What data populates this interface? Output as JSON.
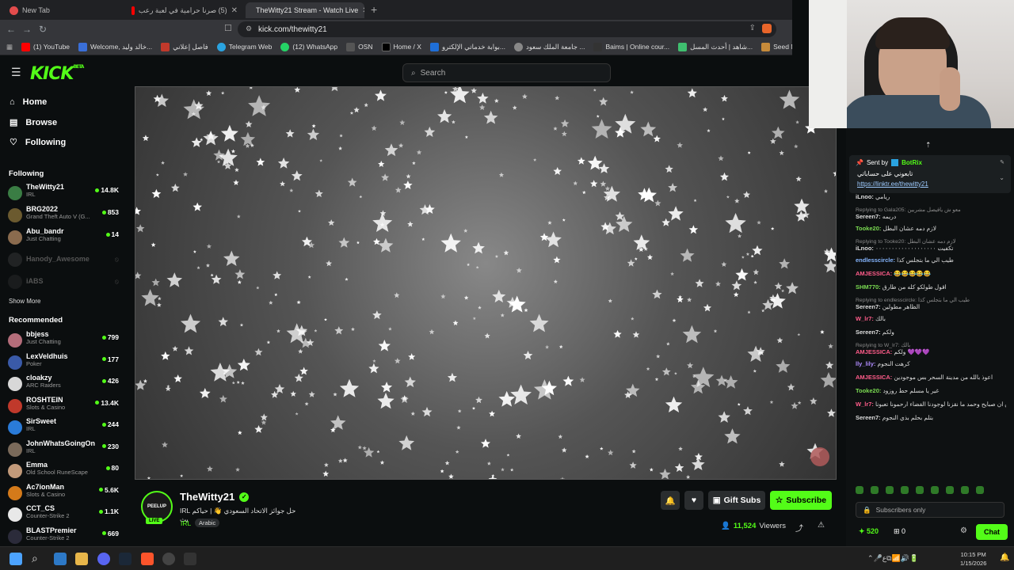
{
  "browser": {
    "tabs": [
      {
        "label": "New Tab"
      },
      {
        "label": "(5) صرنا حرامية في لعبة رعب"
      },
      {
        "label": "TheWitty21 Stream - Watch Live"
      }
    ],
    "url": "kick.com/thewitty21",
    "bookmarks": [
      "(1) YouTube",
      "Welcome, خالد وليد...",
      "فاصل إعلاني",
      "Telegram Web",
      "(12) WhatsApp",
      "OSN",
      "Home / X",
      "بوابة خدماتي الإلكترو...",
      "جامعة الملك سعود ...",
      "Baims | Online cour...",
      "شاهد | أحدث المسل...",
      "Seed Map - Minecra..."
    ]
  },
  "header": {
    "logo": "KICK",
    "logo_badge": "BETA",
    "search_placeholder": "Search"
  },
  "sidebar": {
    "nav": [
      {
        "label": "Home"
      },
      {
        "label": "Browse"
      },
      {
        "label": "Following"
      }
    ],
    "following_title": "Following",
    "following": [
      {
        "name": "TheWitty21",
        "category": "IRL",
        "viewers": "14.8K",
        "color": "#3a7d44"
      },
      {
        "name": "BRG2022",
        "category": "Grand Theft Auto V (G...",
        "viewers": "853",
        "color": "#6b5a2f"
      },
      {
        "name": "Abu_bandr",
        "category": "Just Chatting",
        "viewers": "14",
        "color": "#8a6b4e"
      },
      {
        "name": "Hanody_Awesome",
        "category": "",
        "viewers": "",
        "color": "#444"
      },
      {
        "name": "iABS",
        "category": "",
        "viewers": "",
        "color": "#333"
      }
    ],
    "show_more": "Show More",
    "recommended_title": "Recommended",
    "recommended": [
      {
        "name": "bbjess",
        "category": "Just Chatting",
        "viewers": "799",
        "color": "#b46d7a"
      },
      {
        "name": "LexVeldhuis",
        "category": "Poker",
        "viewers": "177",
        "color": "#3a5aa8"
      },
      {
        "name": "cloakzy",
        "category": "ARC Raiders",
        "viewers": "426",
        "color": "#d8d8d8"
      },
      {
        "name": "ROSHTEIN",
        "category": "Slots & Casino",
        "viewers": "13.4K",
        "color": "#c0392b"
      },
      {
        "name": "SirSweet",
        "category": "IRL",
        "viewers": "244",
        "color": "#2a7bd8"
      },
      {
        "name": "JohnWhatsGoingOn",
        "category": "IRL",
        "viewers": "230",
        "color": "#7a6a5a"
      },
      {
        "name": "Emma",
        "category": "Old School RuneScape",
        "viewers": "80",
        "color": "#c29a7a"
      },
      {
        "name": "Ac7ionMan",
        "category": "Slots & Casino",
        "viewers": "5.6K",
        "color": "#d47a1a"
      },
      {
        "name": "CCT_CS",
        "category": "Counter-Strike 2",
        "viewers": "1.1K",
        "color": "#e8e8e8"
      },
      {
        "name": "BLASTPremier",
        "category": "Counter-Strike 2",
        "viewers": "669",
        "color": "#2b2b3a"
      }
    ]
  },
  "stream": {
    "channel": "TheWitty21",
    "title": "حل جوائز الاتحاد السعودي 👋 | حياكم IRL بث",
    "category": "IRL",
    "tag": "Arabic",
    "live_badge": "LIVE",
    "avatar_text": "PEELUP",
    "viewers_count": "11,524",
    "viewers_label": "Viewers",
    "gift_label": "Gift Subs",
    "subscribe_label": "Subscribe"
  },
  "chat": {
    "pinned_sender_prefix": "Sent by",
    "pinned_sender": "BotRix",
    "pinned_text": "تابعوني على حساباتي",
    "pinned_link": "https://linktr.ee/thewitty21",
    "messages": [
      {
        "reply": "",
        "user": "iLnoo:",
        "text": "ريامي",
        "color": "#ddd"
      },
      {
        "reply": "Replying to Gala205: معو ش يافيصل مشربين",
        "user": "Sereen7:",
        "text": "دريمه",
        "color": "#ddd"
      },
      {
        "reply": "",
        "user": "Tooke20:",
        "text": "لازم دمه عشان البطل",
        "color": "#7bdc52"
      },
      {
        "reply": "Replying to Tooke20: لازم دمه عشان البطل",
        "user": "iLnoo:",
        "text": "تكفيت ٠٠٠٠٠٠٠٠٠٠٠٠٠٠٠٠٠٠٠",
        "color": "#ddd"
      },
      {
        "reply": "",
        "user": "endlesscircle:",
        "text": "طيب الي ما بتجلس كذا",
        "color": "#86b6ff"
      },
      {
        "reply": "",
        "user": "AMJESSICA:",
        "text": "😂😂😂😂😂",
        "color": "#ff5c8a"
      },
      {
        "reply": "",
        "user": "SHM770:",
        "text": "اقول طولكو كله من طارق",
        "color": "#7bdc52"
      },
      {
        "reply": "Replying to endlesscircle: طيب الي ما بتجلس كذا",
        "user": "Sereen7:",
        "text": "الظاهر مطولين",
        "color": "#ddd"
      },
      {
        "reply": "",
        "user": "W_lr7:",
        "text": "بالك",
        "color": "#ff5c8a"
      },
      {
        "reply": "",
        "user": "Sereen7:",
        "text": "ولكم",
        "color": "#ddd"
      },
      {
        "reply": "Replying to W_lr7: بالك",
        "user": "AMJESSICA:",
        "text": "ولكم 💜💜💜",
        "color": "#ff5c8a"
      },
      {
        "reply": "",
        "user": "lly_lily:",
        "text": "كرهت النجوم",
        "color": "#b08cff"
      },
      {
        "reply": "",
        "user": "AMJESSICA:",
        "text": "اعوذ بالله من مدينة السحر بس موجودين",
        "color": "#ff5c8a"
      },
      {
        "reply": "",
        "user": "Tooke20:",
        "text": "غير يا مسلم حط روزود",
        "color": "#7bdc52"
      },
      {
        "reply": "",
        "user": "W_lr7:",
        "text": "شذا يمشي فوق ان صبايح وحمد ما نقزنا لوجودنا الفضاء ارحمونا تعبونا",
        "color": "#ff5c8a"
      },
      {
        "reply": "",
        "user": "Sereen7:",
        "text": "بتلم بحلم بذي النجوم",
        "color": "#ddd"
      }
    ],
    "input_placeholder": "Subscribers only",
    "points": "520",
    "count": "0",
    "send_label": "Chat"
  },
  "taskbar": {
    "time": "10:15 PM",
    "date": "1/15/2026"
  },
  "colors": {
    "accent": "#53fc18",
    "background": "#0b0e0f"
  }
}
